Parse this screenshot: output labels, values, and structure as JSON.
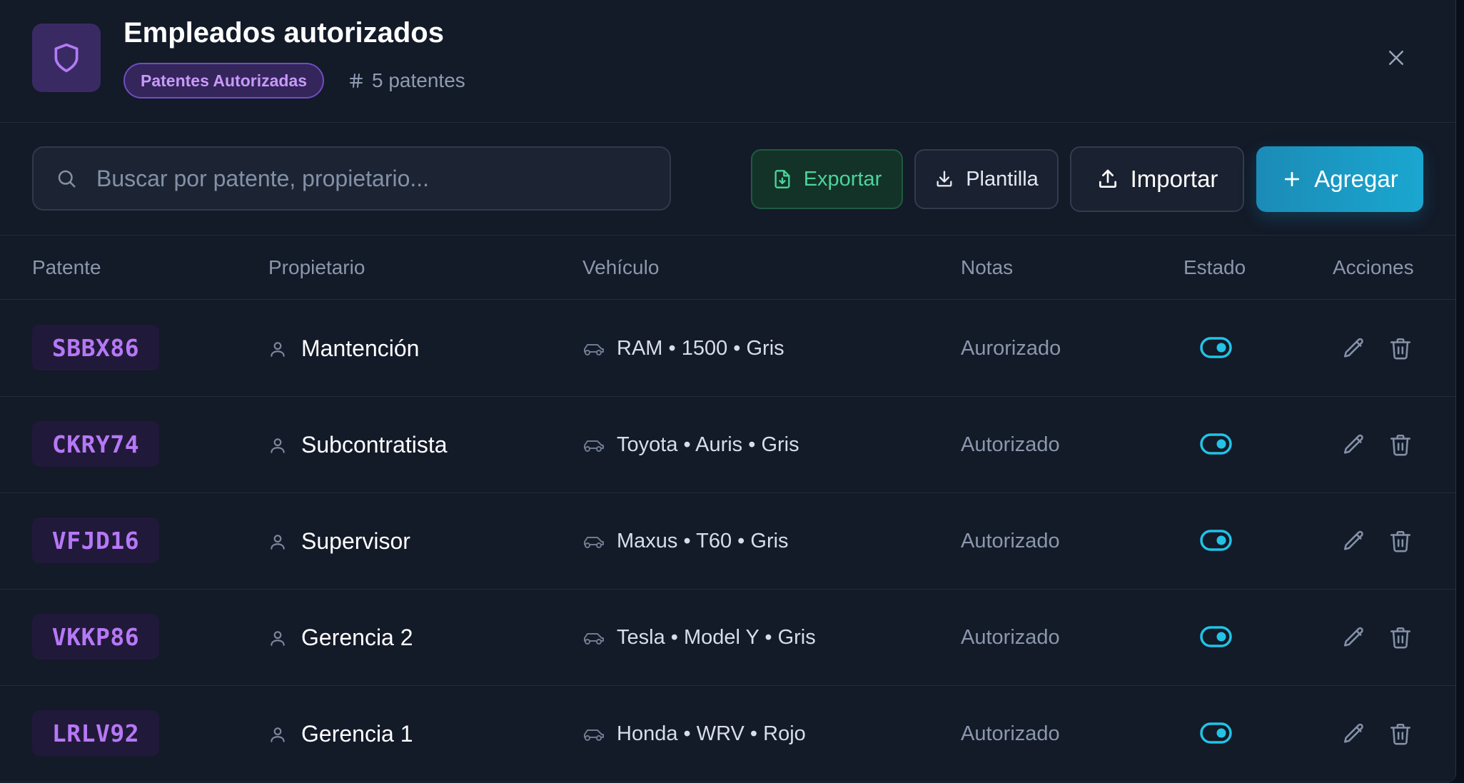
{
  "header": {
    "title": "Empleados autorizados",
    "category_badge": "Patentes Autorizadas",
    "count_label": "5 patentes",
    "icon": "shield-icon"
  },
  "toolbar": {
    "search_placeholder": "Buscar por patente, propietario...",
    "search_value": "",
    "export_label": "Exportar",
    "template_label": "Plantilla",
    "import_label": "Importar",
    "add_label": "Agregar"
  },
  "table": {
    "columns": [
      "Patente",
      "Propietario",
      "Vehículo",
      "Notas",
      "Estado",
      "Acciones"
    ],
    "rows": [
      {
        "plate": "SBBX86",
        "owner": "Mantención",
        "vehicle": "RAM • 1500 • Gris",
        "notes": "Aurorizado",
        "active": true
      },
      {
        "plate": "CKRY74",
        "owner": "Subcontratista",
        "vehicle": "Toyota • Auris • Gris",
        "notes": "Autorizado",
        "active": true
      },
      {
        "plate": "VFJD16",
        "owner": "Supervisor",
        "vehicle": "Maxus • T60 • Gris",
        "notes": "Autorizado",
        "active": true
      },
      {
        "plate": "VKKP86",
        "owner": "Gerencia 2",
        "vehicle": "Tesla • Model Y • Gris",
        "notes": "Autorizado",
        "active": true
      },
      {
        "plate": "LRLV92",
        "owner": "Gerencia 1",
        "vehicle": "Honda • WRV • Rojo",
        "notes": "Autorizado",
        "active": true
      }
    ]
  },
  "colors": {
    "background": "#131a28",
    "accent_purple": "#b678f6",
    "accent_cyan": "#22c3e6",
    "export_green": "#4ad49c",
    "add_button": "#1aa7d0"
  }
}
